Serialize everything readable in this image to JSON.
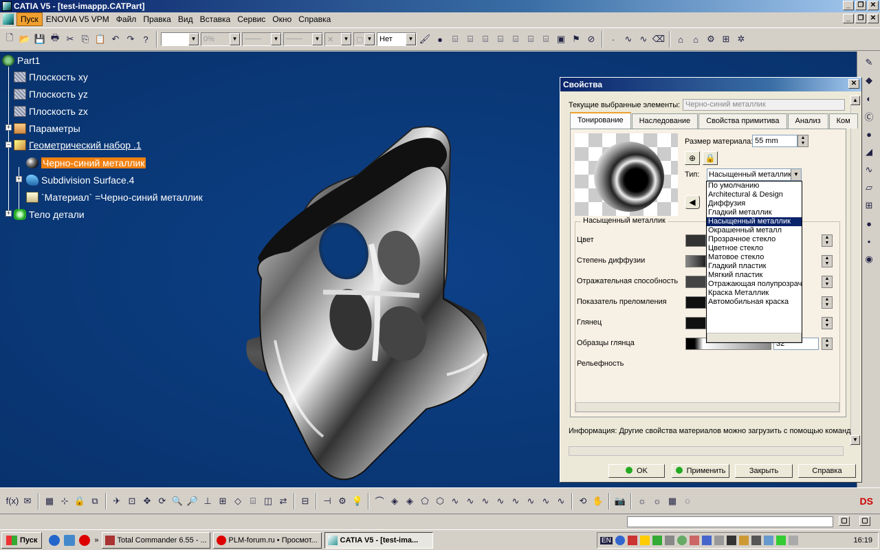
{
  "window": {
    "title": "CATIA V5 - [test-imappp.CATPart]"
  },
  "menu": {
    "items": [
      "Пуск",
      "ENOVIA V5 VPM",
      "Файл",
      "Правка",
      "Вид",
      "Вставка",
      "Сервис",
      "Окно",
      "Справка"
    ]
  },
  "toolbar": {
    "transparency_value": "0%",
    "layer_value": "Нет"
  },
  "tree": {
    "root": "Part1",
    "nodes": [
      "Плоскость xy",
      "Плоскость yz",
      "Плоскость zx",
      "Параметры",
      "Геометрический набор .1",
      "Черно-синий металлик",
      "Subdivision Surface.4",
      "`Материал` =Черно-синий металлик",
      "Тело детали"
    ]
  },
  "dialog": {
    "title": "Свойства",
    "current_label": "Текущие выбранные элементы:",
    "current_value": "Черно-синий металлик",
    "tabs": [
      "Тонирование",
      "Наследование",
      "Свойства примитива",
      "Анализ",
      "Ком"
    ],
    "size_label": "Размер материала:",
    "size_value": "55 mm",
    "type_label": "Тип:",
    "type_value": "Насыщенный металлик",
    "group_title": "Насыщенный металлик",
    "properties": [
      "Цвет",
      "Степень диффузии",
      "Отражательная способность",
      "Показатель преломления",
      "Глянец",
      "Образцы глянца",
      "Рельефность"
    ],
    "gloss_samples_value": "32",
    "info": "Информация: Другие свойства материалов можно загрузить с помощью команд",
    "buttons": {
      "ok": "OK",
      "apply": "Применить",
      "close": "Закрыть",
      "help": "Справка"
    },
    "type_options": [
      "По умолчанию",
      "Architectural & Design",
      "Диффузия",
      "Гладкий металлик",
      "Насыщенный металлик",
      "Окрашенный металл",
      "Прозрачное стекло",
      "Цветное стекло",
      "Матовое стекло",
      "Гладкий пластик",
      "Мягкий пластик",
      "Отражающая полупрозрачность",
      "Краска Металлик",
      "Автомобильная краска"
    ],
    "selected_option_index": 4
  },
  "taskbar": {
    "start": "Пуск",
    "more": "»",
    "tasks": [
      "Total Commander 6.55 - ...",
      "PLM-forum.ru • Просмот...",
      "CATIA V5 - [test-ima..."
    ],
    "lang": "EN",
    "clock": "16:19"
  },
  "colors": {
    "viewport_bg": "#0a3a7a",
    "selection": "#f08010",
    "title_bar": "#0a246a"
  }
}
